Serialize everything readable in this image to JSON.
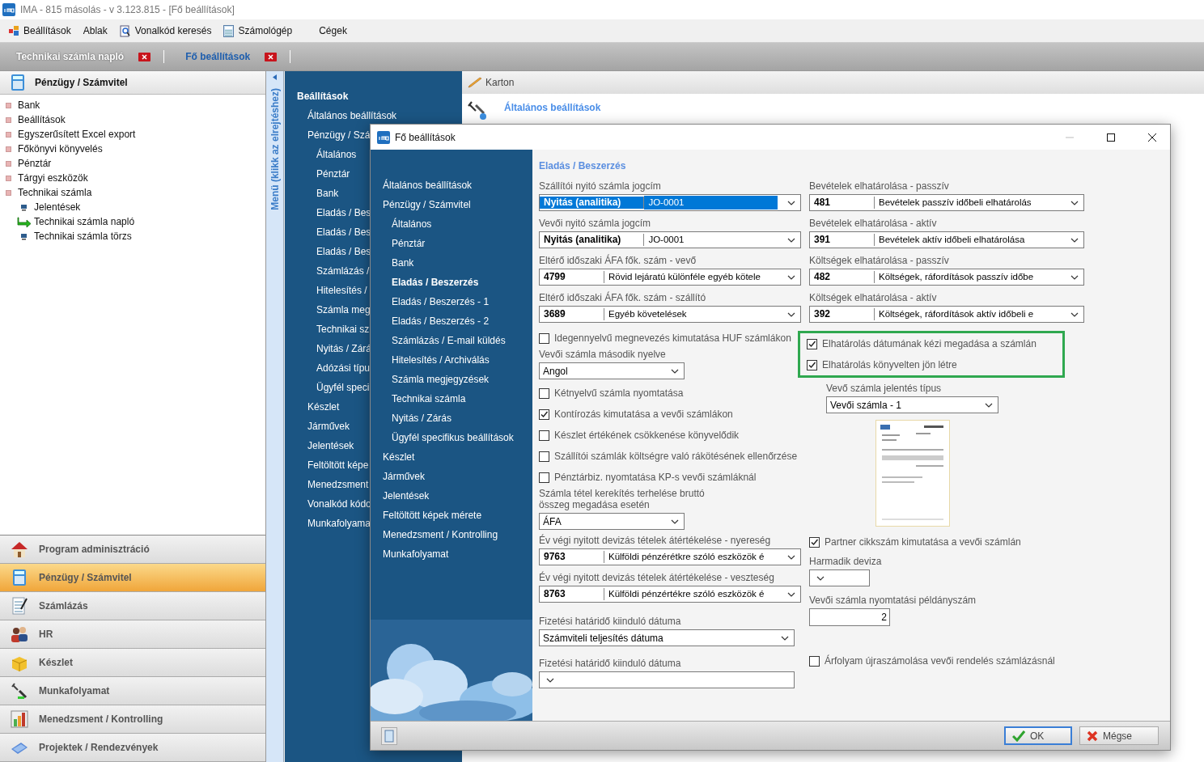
{
  "window": {
    "title": "IMA - 815 másolás - v 3.123.815 - [Fő beállítások]"
  },
  "menu": [
    {
      "label": "Beállítások",
      "kind": "settings"
    },
    {
      "label": "Ablak",
      "kind": "plain"
    },
    {
      "label": "Vonalkód keresés",
      "kind": "search"
    },
    {
      "label": "Számológép",
      "kind": "calculator"
    },
    {
      "label": "Cégek",
      "kind": "plain"
    }
  ],
  "doc_tabs": [
    {
      "label": "Technikai számla napló",
      "selected": false
    },
    {
      "label": "Fő beállítások",
      "selected": true
    }
  ],
  "module_panel": {
    "title": "Pénzügy / Számvitel",
    "tree": [
      {
        "label": "Bank"
      },
      {
        "label": "Beállítások"
      },
      {
        "label": "Egyszerűsített Excel export"
      },
      {
        "label": "Főkönyvi könyvelés"
      },
      {
        "label": "Pénztár"
      },
      {
        "label": "Tárgyi eszközök"
      },
      {
        "label": "Technikai számla",
        "children": [
          {
            "label": "Jelentések",
            "kind": "doc"
          },
          {
            "label": "Technikai számla napló",
            "kind": "arrow"
          },
          {
            "label": "Technikai számla törzs",
            "kind": "doc"
          }
        ]
      }
    ]
  },
  "modules": [
    {
      "label": "Program adminisztráció",
      "kind": "home",
      "selected": false
    },
    {
      "label": "Pénzügy / Számvitel",
      "kind": "calculator",
      "selected": true
    },
    {
      "label": "Számlázás",
      "kind": "notepad",
      "selected": false
    },
    {
      "label": "HR",
      "kind": "people",
      "selected": false
    },
    {
      "label": "Készlet",
      "kind": "box",
      "selected": false
    },
    {
      "label": "Munkafolyamat",
      "kind": "tools",
      "selected": false
    },
    {
      "label": "Menedzsment / Kontrolling",
      "kind": "chart",
      "selected": false
    },
    {
      "label": "Projektek / Rendezvények",
      "kind": "folder",
      "selected": false
    }
  ],
  "menu_strip": {
    "label": "Menü (klikk az elrejtéshez)"
  },
  "settings_menu": {
    "title": "Beállítások",
    "items": [
      {
        "label": "Általános beállítások"
      },
      {
        "label": "Pénzügy / Szá",
        "children": [
          {
            "label": "Általános"
          },
          {
            "label": "Pénztár"
          },
          {
            "label": "Bank"
          },
          {
            "label": "Eladás / Bes"
          },
          {
            "label": "Eladás / Bes"
          },
          {
            "label": "Eladás / Bes"
          },
          {
            "label": "Számlázás /"
          },
          {
            "label": "Hitelesítés /"
          },
          {
            "label": "Számla meg"
          },
          {
            "label": "Technikai sz"
          },
          {
            "label": "Nyitás / Zárá"
          },
          {
            "label": "Adózási típu"
          },
          {
            "label": "Ügyfél speci"
          }
        ]
      },
      {
        "label": "Készlet"
      },
      {
        "label": "Járművek"
      },
      {
        "label": "Jelentések"
      },
      {
        "label": "Feltöltött képe"
      },
      {
        "label": "Menedzsment"
      },
      {
        "label": "Vonalkód kódo"
      },
      {
        "label": "Munkafolyama"
      }
    ]
  },
  "content": {
    "toolbar_label": "Karton",
    "heading": "Általános beállítások"
  },
  "dialog": {
    "title": "Fő beállítások",
    "nav": [
      {
        "label": "Általános beállítások",
        "selected": false
      },
      {
        "label": "Pénzügy / Számvitel",
        "selected": false,
        "children": [
          {
            "label": "Általános",
            "selected": false
          },
          {
            "label": "Pénztár",
            "selected": false
          },
          {
            "label": "Bank",
            "selected": false
          },
          {
            "label": "Eladás / Beszerzés",
            "selected": true
          },
          {
            "label": "Eladás / Beszerzés - 1",
            "selected": false
          },
          {
            "label": "Eladás / Beszerzés - 2",
            "selected": false
          },
          {
            "label": "Számlázás / E-mail küldés",
            "selected": false
          },
          {
            "label": "Hitelesítés / Archiválás",
            "selected": false
          },
          {
            "label": "Számla megjegyzések",
            "selected": false
          },
          {
            "label": "Technikai számla",
            "selected": false
          },
          {
            "label": "Nyitás / Zárás",
            "selected": false
          },
          {
            "label": "Ügyfél specifikus beállítások",
            "selected": false
          }
        ]
      },
      {
        "label": "Készlet",
        "selected": false
      },
      {
        "label": "Járművek",
        "selected": false
      },
      {
        "label": "Jelentések",
        "selected": false
      },
      {
        "label": "Feltöltött képek mérete",
        "selected": false
      },
      {
        "label": "Menedzsment / Kontrolling",
        "selected": false
      },
      {
        "label": "Munkafolyamat",
        "selected": false
      }
    ],
    "section_title": "Eladás / Beszerzés",
    "left_fields": [
      {
        "kind": "combo",
        "label": "Szállítói nyitó számla jogcím",
        "code": "Nyitás (analitika)",
        "text": "JO-0001",
        "focused": true
      },
      {
        "kind": "combo",
        "label": "Vevői nyitó számla jogcím",
        "code": "Nyitás (analitika)",
        "text": "JO-0001",
        "focused": false
      },
      {
        "kind": "combo",
        "label": "Eltérő időszaki ÁFA fők. szám - vevő",
        "code": "4799",
        "text": "Rövid lejáratú különféle egyéb kötele",
        "focused": false
      },
      {
        "kind": "combo",
        "label": "Eltérő időszaki ÁFA fők. szám - szállító",
        "code": "3689",
        "text": "Egyéb követelések",
        "focused": false
      },
      {
        "kind": "check",
        "label": "Idegennyelvű megnevezés kimutatása HUF számlákon",
        "checked": false
      },
      {
        "kind": "shortselect",
        "label": "Vevői számla második nyelve",
        "value": "Angol"
      },
      {
        "kind": "check",
        "label": "Kétnyelvű számla nyomtatása",
        "checked": false
      },
      {
        "kind": "check",
        "label": "Kontírozás kimutatása a vevői számlákon",
        "checked": true
      },
      {
        "kind": "check",
        "label": "Készlet értékének csökkenése könyvelődik",
        "checked": false
      },
      {
        "kind": "check",
        "label": "Szállítói számlák költségre való rákötésének ellenőrzése",
        "checked": false
      },
      {
        "kind": "check",
        "label": "Pénztárbiz. nyomtatása KP-s vevői számláknál",
        "checked": false
      },
      {
        "kind": "shortselect",
        "label": "Számla tétel kerekítés terhelése bruttó összeg megadása esetén",
        "value": "ÁFA"
      },
      {
        "kind": "combo",
        "label": "Év végi nyitott devizás tételek átértékelése - nyereség",
        "code": "9763",
        "text": "Külföldi pénzérétkre szóló eszközök é",
        "focused": false
      },
      {
        "kind": "combo",
        "label": "Év végi nyitott devizás tételek átértékelése - veszteség",
        "code": "8763",
        "text": "Külföldi pénzértékre szóló eszközök é",
        "focused": false
      },
      {
        "kind": "select",
        "label": "Fizetési határidő kiinduló dátuma",
        "value": "Számviteli teljesítés dátuma"
      },
      {
        "kind": "select",
        "label": "Fizetési határidő kiinduló dátuma"
      }
    ],
    "right_fields": [
      {
        "kind": "combo",
        "label": "Bevételek elhatárolása - passzív",
        "code": "481",
        "text": "Bevételek passzív időbeli elhatárolás",
        "focused": false
      },
      {
        "kind": "combo",
        "label": "Bevételek elhatárolása - aktív",
        "code": "391",
        "text": "Bevételek aktív időbeli elhatárolása",
        "focused": false
      },
      {
        "kind": "combo",
        "label": "Költségek elhatárolása - passzív",
        "code": "482",
        "text": "Költségek, ráfordítások passzív időbe",
        "focused": false
      },
      {
        "kind": "combo",
        "label": "Költségek elhatárolása - aktív",
        "code": "392",
        "text": "Költségek, ráfordítások aktív időbeli e",
        "focused": false
      },
      {
        "kind": "highlight",
        "items": [
          {
            "label": "Elhatárolás dátumának kézi megadása a számlán",
            "checked": true
          },
          {
            "label": "Elhatárolás könyvelten jön létre",
            "checked": true
          }
        ]
      },
      {
        "kind": "select",
        "label": "Vevő számla jelentés típus",
        "value": "Vevői számla - 1"
      },
      {
        "kind": "preview"
      },
      {
        "kind": "check",
        "label": "Partner cikkszám kimutatása a vevői számlán",
        "checked": true
      },
      {
        "kind": "shortselect",
        "label": "Harmadik deviza"
      },
      {
        "kind": "number",
        "label": "Vevői számla nyomtatási példányszám",
        "value": "2"
      },
      {
        "kind": "check",
        "label": "Árfolyam újraszámolása vevői rendelés számlázásnál",
        "checked": false
      }
    ],
    "buttons": [
      {
        "label": "OK",
        "kind": "ok",
        "focused": true
      },
      {
        "label": "Mégse",
        "kind": "cancel",
        "focused": false
      }
    ]
  }
}
